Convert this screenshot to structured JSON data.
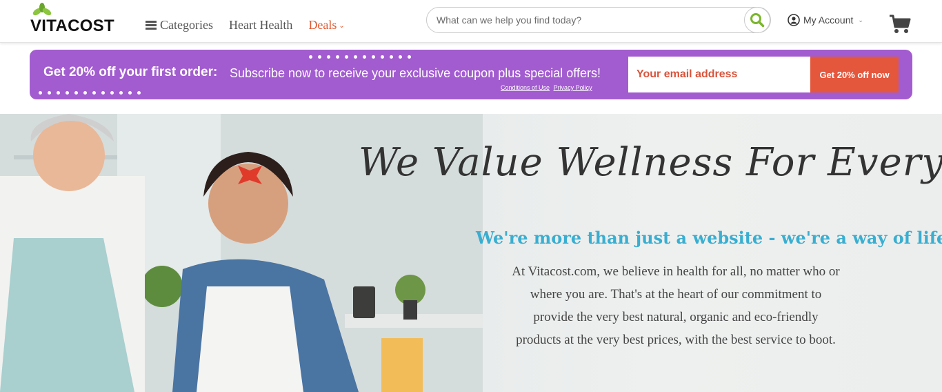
{
  "header": {
    "logo_text": "VITACOST",
    "nav": [
      {
        "label": "Categories"
      },
      {
        "label": "Heart Health"
      },
      {
        "label": "Deals"
      }
    ],
    "search": {
      "placeholder": "What can we help you find today?"
    },
    "account_label": "My Account",
    "icons": [
      "hamburger-icon",
      "search-icon",
      "user-icon",
      "chevron-down-icon",
      "cart-icon",
      "leaf-logo-icon"
    ]
  },
  "promo": {
    "title": "Get 20% off your first order:",
    "subtitle": "Subscribe now to receive your exclusive coupon plus special offers!",
    "links": [
      "Conditions of Use",
      "Privacy Policy"
    ],
    "email_placeholder": "Your email address",
    "cta_label": "Get 20% off now",
    "colors": {
      "banner": "#a25ccf",
      "cta": "#e4573d"
    }
  },
  "hero": {
    "title": "We Value Wellness For Everyone",
    "tagline": "We're more than just a website - we're a way of life!",
    "body": "At Vitacost.com, we believe in health for all, no matter who or where you are. That's at the heart of our commitment to provide the very best natural, organic and eco-friendly products at the very best prices, with the best service to boot.",
    "colors": {
      "tagline": "#3aaed0"
    }
  },
  "colors": {
    "deals_accent": "#e05a32",
    "search_icon": "#7bb52e"
  }
}
